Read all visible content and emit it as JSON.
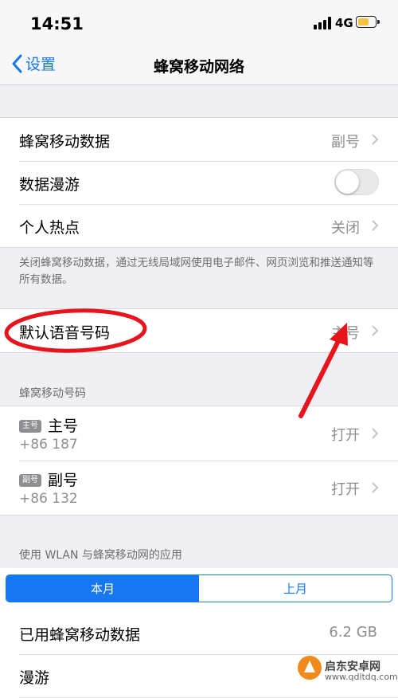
{
  "status_bar": {
    "time": "14:51",
    "network": "4G"
  },
  "nav": {
    "back_label": "设置",
    "title": "蜂窝移动网络"
  },
  "settings": {
    "cellular_data": {
      "label": "蜂窝移动数据",
      "value": "副号"
    },
    "data_roaming": {
      "label": "数据漫游",
      "enabled": false
    },
    "hotspot": {
      "label": "个人热点",
      "value": "关闭"
    }
  },
  "note": "关闭蜂窝移动数据，通过无线局域网使用电子邮件、网页浏览和推送通知等所有数据。",
  "default_voice": {
    "label": "默认语音号码",
    "value": "主号"
  },
  "plans_header": "蜂窝移动号码",
  "plans": [
    {
      "badge": "主号",
      "name": "主号",
      "number": "+86 187",
      "status": "打开"
    },
    {
      "badge": "副号",
      "name": "副号",
      "number": "+86 132",
      "status": "打开"
    }
  ],
  "usage_header": "使用 WLAN 与蜂窝移动网的应用",
  "usage_tabs": {
    "current": "本月",
    "previous": "上月"
  },
  "usage": [
    {
      "label": "已用蜂窝移动数据",
      "value": "6.2 GB"
    },
    {
      "label": "漫游",
      "value": ""
    }
  ],
  "watermark": {
    "name": "启东安卓网",
    "url": "www.qdltdq.com"
  },
  "colors": {
    "accent": "#1677f2",
    "annotation": "#e8141c",
    "badge": "#8e8e93"
  }
}
